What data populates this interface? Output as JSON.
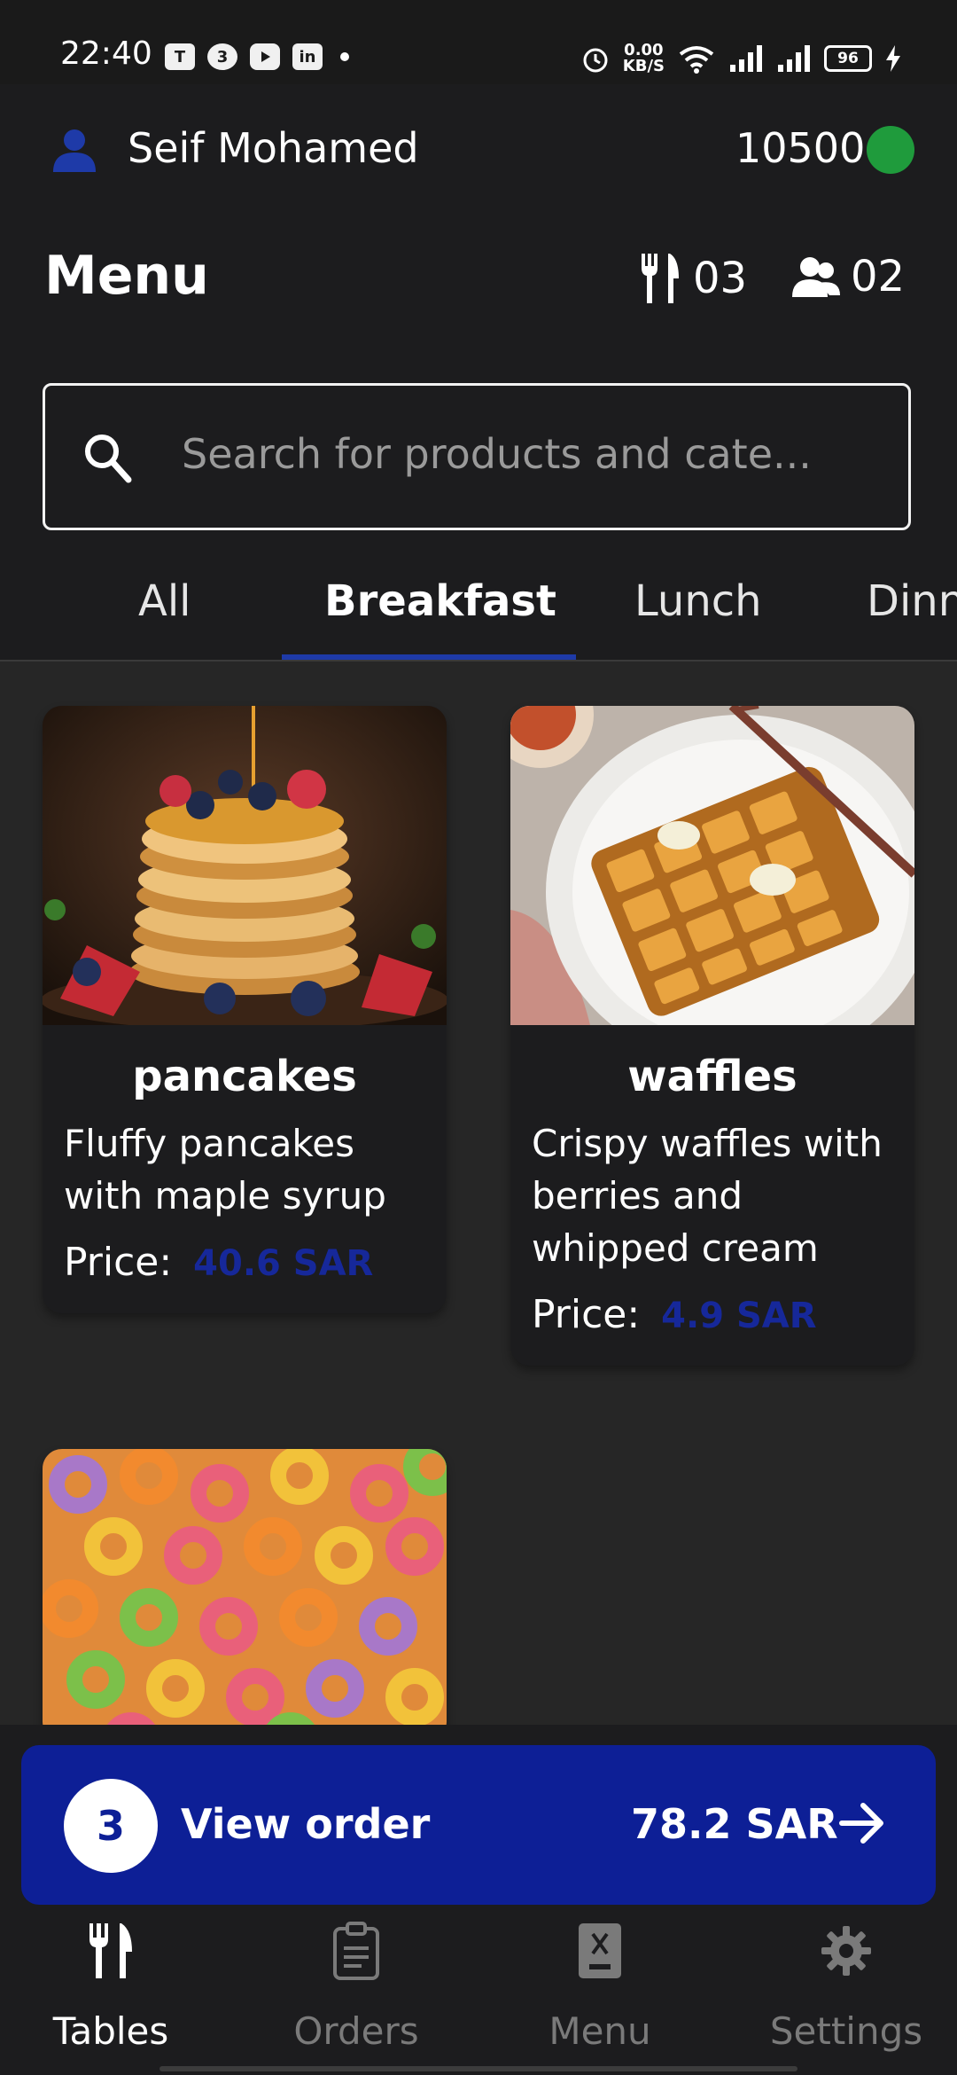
{
  "status_bar": {
    "time": "22:40",
    "app_icons": [
      "teams-icon",
      "365-icon",
      "youtube-icon",
      "linkedin-icon"
    ],
    "net_speed_value": "0.00",
    "net_speed_unit": "KB/S",
    "battery": "96"
  },
  "header": {
    "user_name": "Seif Mohamed",
    "balance": "10500",
    "status_color": "#1f9b3c"
  },
  "page": {
    "title": "Menu",
    "tables_count": "03",
    "guests_count": "02"
  },
  "search": {
    "placeholder": "Search for products and cate..."
  },
  "tabs": [
    {
      "label": "All"
    },
    {
      "label": "Breakfast",
      "active": true
    },
    {
      "label": "Lunch"
    },
    {
      "label": "Dinn"
    }
  ],
  "products": [
    {
      "name": "pancakes",
      "description": "Fluffy pancakes with maple syrup",
      "price_label": "Price:",
      "price": "40.6 SAR",
      "image": "pancakes-photo"
    },
    {
      "name": "waffles",
      "description": "Crispy waffles with berries and whipped cream",
      "price_label": "Price:",
      "price": "4.9 SAR",
      "image": "waffles-photo"
    },
    {
      "image": "cereal-photo"
    }
  ],
  "order_bar": {
    "item_count": "3",
    "label": "View order",
    "total": "78.2 SAR",
    "accent": "#0d1f96"
  },
  "bottom_nav": [
    {
      "label": "Tables",
      "icon": "cutlery-icon",
      "active": true
    },
    {
      "label": "Orders",
      "icon": "clipboard-icon"
    },
    {
      "label": "Menu",
      "icon": "menu-book-icon"
    },
    {
      "label": "Settings",
      "icon": "gear-icon"
    }
  ],
  "colors": {
    "background": "#262626",
    "surface": "#1c1c1e",
    "accent": "#1e3aa8",
    "price": "#16289a"
  }
}
